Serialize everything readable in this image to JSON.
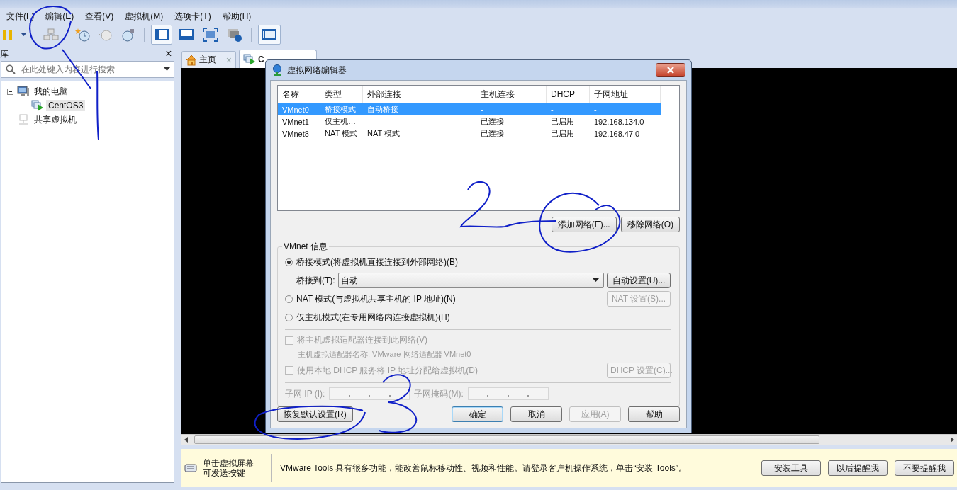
{
  "menu": [
    "文件(F)",
    "编辑(E)",
    "查看(V)",
    "虚拟机(M)",
    "选项卡(T)",
    "帮助(H)"
  ],
  "library": {
    "title": "库",
    "close": "×",
    "search_placeholder": "在此处键入内容进行搜索",
    "tree": [
      {
        "label": "我的电脑",
        "kind": "computer",
        "selected": false,
        "expanded": true,
        "children": [
          {
            "label": "CentOS3",
            "kind": "vm",
            "selected": true
          }
        ]
      },
      {
        "label": "共享虚拟机",
        "kind": "shared",
        "selected": false
      }
    ]
  },
  "tabs": [
    {
      "label": "主页",
      "kind": "home",
      "selected": false,
      "close": "×"
    },
    {
      "label": "C",
      "kind": "vm",
      "selected": true
    }
  ],
  "dialog": {
    "title": "虚拟网络编辑器",
    "table": {
      "columns": [
        "名称",
        "类型",
        "外部连接",
        "主机连接",
        "DHCP",
        "子网地址"
      ],
      "rows": [
        {
          "cells": [
            "VMnet0",
            "桥接模式",
            "自动桥接",
            "-",
            "-",
            "-"
          ],
          "selected": true
        },
        {
          "cells": [
            "VMnet1",
            "仅主机…",
            "-",
            "已连接",
            "已启用",
            "192.168.134.0"
          ],
          "selected": false
        },
        {
          "cells": [
            "VMnet8",
            "NAT 模式",
            "NAT 模式",
            "已连接",
            "已启用",
            "192.168.47.0"
          ],
          "selected": false
        }
      ]
    },
    "list_buttons": [
      {
        "label": "添加网络(E)...",
        "disabled": false
      },
      {
        "label": "移除网络(O)",
        "disabled": false
      }
    ],
    "info": {
      "title": "VMnet 信息",
      "modes": [
        {
          "label": "桥接模式(将虚拟机直接连接到外部网络)(B)",
          "selected": true
        },
        {
          "label": "NAT 模式(与虚拟机共享主机的 IP 地址)(N)",
          "selected": false
        },
        {
          "label": "仅主机模式(在专用网络内连接虚拟机)(H)",
          "selected": false
        }
      ],
      "bridge_label": "桥接到(T):",
      "bridge_value": "自动",
      "auto_button": {
        "label": "自动设置(U)...",
        "disabled": false
      },
      "nat_button": {
        "label": "NAT 设置(S)...",
        "disabled": true
      },
      "adapter_check": {
        "label": "将主机虚拟适配器连接到此网络(V)",
        "checked": false,
        "disabled": true
      },
      "adapter_name": "主机虚拟适配器名称: VMware 网络适配器 VMnet0",
      "dhcp_check": {
        "label": "使用本地 DHCP 服务将 IP 地址分配给虚拟机(D)",
        "checked": false,
        "disabled": true
      },
      "dhcp_button": {
        "label": "DHCP 设置(C)...",
        "disabled": true
      },
      "subnet_ip_label": "子网 IP (I):",
      "subnet_mask_label": "子网掩码(M):"
    },
    "restore_button": {
      "label": "恢复默认设置(R)",
      "disabled": false
    },
    "buttons": [
      {
        "label": "确定",
        "disabled": false,
        "default": true
      },
      {
        "label": "取消",
        "disabled": false,
        "default": false
      },
      {
        "label": "应用(A)",
        "disabled": true,
        "default": false
      },
      {
        "label": "帮助",
        "disabled": false,
        "default": false
      }
    ]
  },
  "notice": {
    "hint_lines": [
      "单击虚拟屏幕",
      "可发送按键"
    ],
    "message": "VMware Tools 具有很多功能，能改善鼠标移动性、视频和性能。请登录客户机操作系统，单击“安装 Tools”。",
    "buttons": [
      "安装工具",
      "以后提醒我",
      "不要提醒我"
    ]
  }
}
